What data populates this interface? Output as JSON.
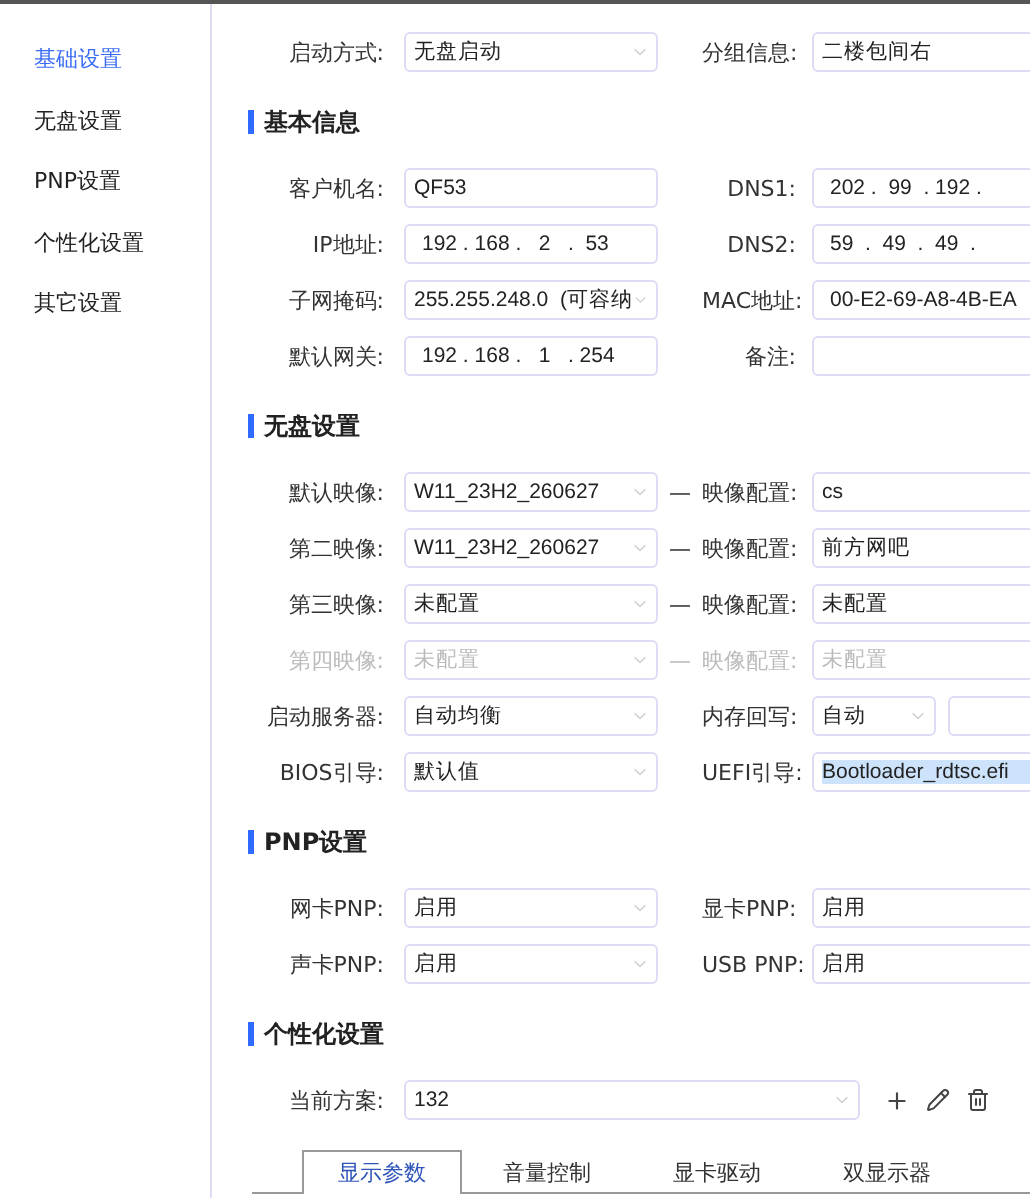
{
  "sidebar": {
    "items": [
      {
        "label": "基础设置",
        "selected": true
      },
      {
        "label": "无盘设置",
        "selected": false
      },
      {
        "label": "PNP设置",
        "selected": false
      },
      {
        "label": "个性化设置",
        "selected": false
      },
      {
        "label": "其它设置",
        "selected": false
      }
    ]
  },
  "top_row": {
    "left": {
      "label": "启动方式:",
      "field": {
        "kind": "select",
        "value": "无盘启动"
      }
    },
    "right": {
      "label": "分组信息:",
      "fields": [
        {
          "kind": "text",
          "value": "二楼包间右"
        }
      ]
    }
  },
  "sections": [
    {
      "title": "基本信息",
      "rows": [
        {
          "disabled": false,
          "left": {
            "label": "客户机名:",
            "field": {
              "kind": "text",
              "value": "QF53"
            }
          },
          "right": {
            "label": "DNS1:",
            "fields": [
              {
                "kind": "ip",
                "value": "202 .  99  . 192 ."
              }
            ]
          }
        },
        {
          "disabled": false,
          "left": {
            "label": "IP地址:",
            "field": {
              "kind": "ip",
              "value": "192 . 168 .   2   .  53"
            }
          },
          "right": {
            "label": "DNS2:",
            "fields": [
              {
                "kind": "ip",
                "value": "59  .  49  .  49  ."
              }
            ]
          }
        },
        {
          "disabled": false,
          "left": {
            "label": "子网掩码:",
            "field": {
              "kind": "select",
              "value": "255.255.248.0  (可容纳"
            }
          },
          "right": {
            "label": "MAC地址:",
            "fields": [
              {
                "kind": "ip",
                "value": "00-E2-69-A8-4B-EA"
              }
            ]
          }
        },
        {
          "disabled": false,
          "left": {
            "label": "默认网关:",
            "field": {
              "kind": "ip",
              "value": "192 . 168 .   1   . 254"
            }
          },
          "right": {
            "label": "备注:",
            "fields": [
              {
                "kind": "text"
              }
            ]
          }
        }
      ]
    },
    {
      "title": "无盘设置",
      "rows": [
        {
          "disabled": false,
          "dash": "—",
          "left": {
            "label": "默认映像:",
            "field": {
              "kind": "select",
              "value": "W11_23H2_260627"
            }
          },
          "right": {
            "label": "映像配置:",
            "fields": [
              {
                "kind": "text",
                "value": "cs"
              }
            ]
          }
        },
        {
          "disabled": false,
          "dash": "—",
          "left": {
            "label": "第二映像:",
            "field": {
              "kind": "select",
              "value": "W11_23H2_260627"
            }
          },
          "right": {
            "label": "映像配置:",
            "fields": [
              {
                "kind": "text",
                "value": "前方网吧"
              }
            ]
          }
        },
        {
          "disabled": false,
          "dash": "—",
          "left": {
            "label": "第三映像:",
            "field": {
              "kind": "select",
              "value": "未配置"
            }
          },
          "right": {
            "label": "映像配置:",
            "fields": [
              {
                "kind": "text",
                "value": "未配置"
              }
            ]
          }
        },
        {
          "disabled": true,
          "dash": "—",
          "left": {
            "label": "第四映像:",
            "field": {
              "kind": "select",
              "value": "未配置"
            }
          },
          "right": {
            "label": "映像配置:",
            "fields": [
              {
                "kind": "text",
                "value": "未配置"
              }
            ]
          }
        },
        {
          "disabled": false,
          "left": {
            "label": "启动服务器:",
            "field": {
              "kind": "select",
              "value": "自动均衡"
            }
          },
          "right": {
            "label": "内存回写:",
            "fields": [
              {
                "kind": "small-select",
                "value": "自动"
              },
              {
                "kind": "text"
              }
            ]
          }
        },
        {
          "disabled": false,
          "left": {
            "label": "BIOS引导:",
            "field": {
              "kind": "select",
              "value": "默认值"
            }
          },
          "right": {
            "label": "UEFI引导:",
            "fields": [
              {
                "kind": "text",
                "value": "Bootloader_rdtsc.efi",
                "highlighted": true
              }
            ]
          }
        }
      ]
    },
    {
      "title": "PNP设置",
      "rows": [
        {
          "disabled": false,
          "left": {
            "label": "网卡PNP:",
            "field": {
              "kind": "select",
              "value": "启用"
            }
          },
          "right": {
            "label": "显卡PNP:",
            "fields": [
              {
                "kind": "text",
                "value": "启用"
              }
            ]
          }
        },
        {
          "disabled": false,
          "left": {
            "label": "声卡PNP:",
            "field": {
              "kind": "select",
              "value": "启用"
            }
          },
          "right": {
            "label": "USB PNP:",
            "fields": [
              {
                "kind": "text",
                "value": "启用"
              }
            ]
          }
        }
      ]
    },
    {
      "title": "个性化设置",
      "scheme": {
        "label": "当前方案:",
        "value": "132"
      },
      "tabs": [
        {
          "label": "显示参数",
          "selected": true
        },
        {
          "label": "音量控制",
          "selected": false
        },
        {
          "label": "显卡驱动",
          "selected": false
        },
        {
          "label": "双显示器",
          "selected": false
        }
      ]
    }
  ]
}
